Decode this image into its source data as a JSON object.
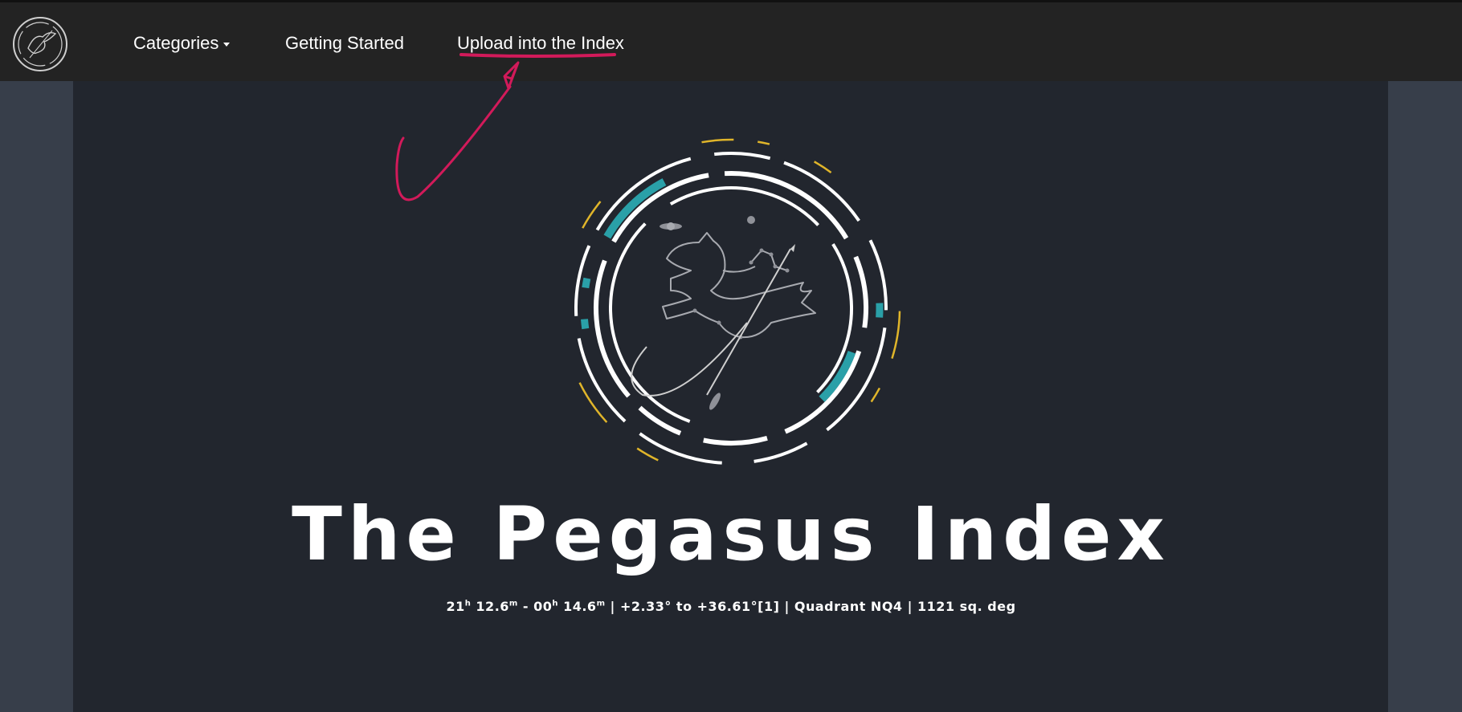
{
  "nav": {
    "logo_icon": "pegasus-logo-icon",
    "categories_label": "Categories",
    "getting_started_label": "Getting Started",
    "upload_label": "Upload into the Index"
  },
  "hero": {
    "logo_icon": "pegasus-constellation-emblem-icon",
    "title": "The Pegasus Index",
    "subtitle": {
      "ra_start_h": "21",
      "ra_start_m": "12.6",
      "sep1": " - ",
      "ra_end_h": "00",
      "ra_end_m": "14.6",
      "rest": " | +2.33° to +36.61°[1] | Quadrant NQ4 | 1121 sq. deg",
      "h_sup": "h",
      "m_sup": "m"
    }
  },
  "annotation": {
    "icon": "hand-drawn-arrow-icon",
    "color": "#d21a5a"
  },
  "colors": {
    "navbar": "#232323",
    "content": "#22262e",
    "side": "#373e4a",
    "teal": "#2aa0a8",
    "gold": "#e0b52a"
  }
}
